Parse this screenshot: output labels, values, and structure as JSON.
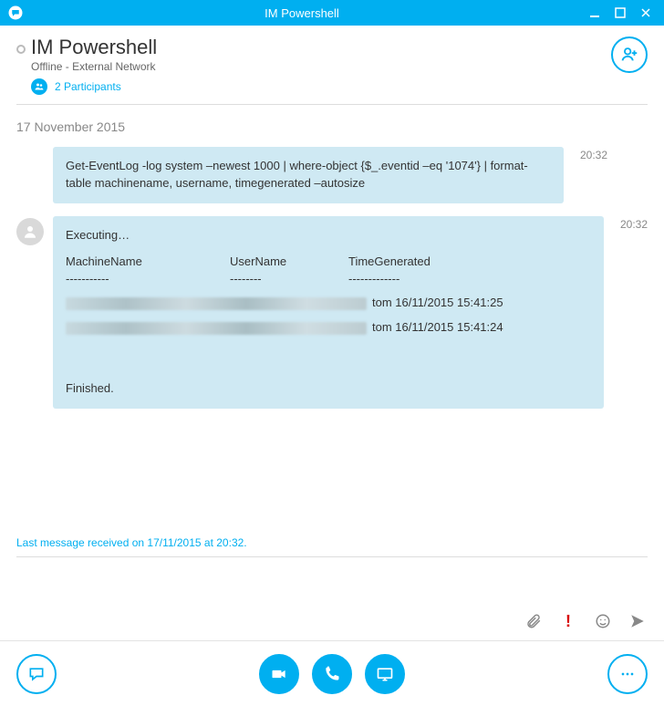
{
  "titlebar": {
    "title": "IM Powershell"
  },
  "header": {
    "title": "IM Powershell",
    "subtitle": "Offline - External Network",
    "participants_label": "2 Participants"
  },
  "conversation": {
    "date_label": "17 November 2015",
    "messages": [
      {
        "time": "20:32",
        "body": "Get-EventLog -log system –newest 1000 | where-object {$_.eventid –eq '1074'} | format-table machinename, username, timegenerated –autosize"
      },
      {
        "time": "20:32",
        "executing": "Executing…",
        "columns": {
          "c1": "MachineName",
          "c2": "UserName",
          "c3": "TimeGenerated"
        },
        "dashes": {
          "d1": "-----------",
          "d2": "--------",
          "d3": "-------------"
        },
        "rows": [
          {
            "tail": "tom 16/11/2015 15:41:25"
          },
          {
            "tail": "tom 16/11/2015 15:41:24"
          }
        ],
        "finished": "Finished."
      }
    ]
  },
  "footer": {
    "last_message": "Last message received on 17/11/2015 at 20:32."
  },
  "icons": {
    "add_user": "add-user-icon",
    "attach": "paperclip-icon",
    "important": "important-icon",
    "emoji": "emoji-icon",
    "send": "send-icon",
    "chat": "chat-icon",
    "video": "video-icon",
    "phone": "phone-icon",
    "present": "present-icon",
    "more": "more-icon"
  }
}
